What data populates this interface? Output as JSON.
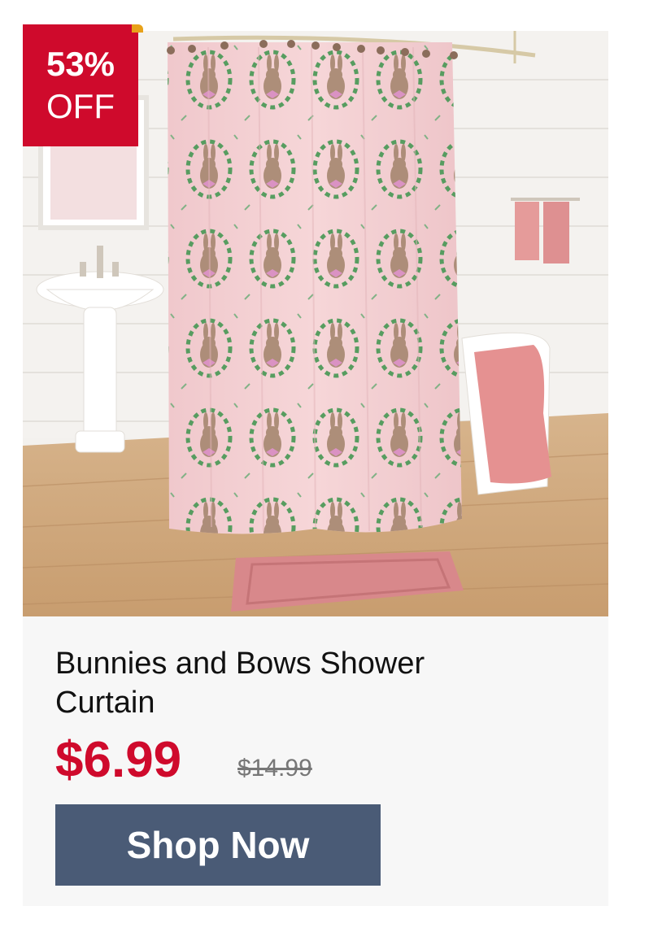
{
  "badge": {
    "percent": "53%",
    "label": "OFF"
  },
  "product": {
    "title": "Bunnies and Bows Shower Curtain",
    "sale_price": "$6.99",
    "original_price": "$14.99",
    "image_alt": "bunnies-and-bows-shower-curtain-photo"
  },
  "cta": {
    "label": "Shop Now"
  },
  "colors": {
    "badge": "#cf0a2c",
    "sale_price": "#cf0a2c",
    "button": "#4a5b76",
    "card_bg": "#f7f7f7"
  }
}
